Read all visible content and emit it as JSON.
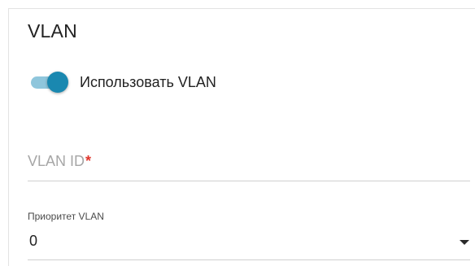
{
  "section": {
    "title": "VLAN"
  },
  "use_vlan": {
    "label": "Использовать VLAN",
    "enabled": true,
    "track_color": "#8fc6dc",
    "thumb_color": "#1a88b0"
  },
  "vlan_id": {
    "placeholder": "VLAN ID",
    "required_mark": "*",
    "value": ""
  },
  "priority": {
    "label": "Приоритет VLAN",
    "value": "0",
    "icon": "chevron-down-icon"
  }
}
